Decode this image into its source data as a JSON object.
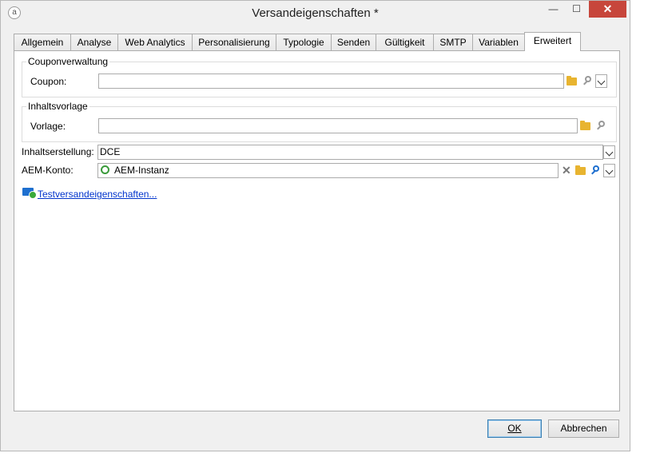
{
  "window": {
    "title": "Versandeigenschaften *",
    "minimize_glyph": "—",
    "maximize_glyph": "☐",
    "close_glyph": "✕"
  },
  "tabs": [
    {
      "label": "Allgemein"
    },
    {
      "label": "Analyse"
    },
    {
      "label": "Web Analytics"
    },
    {
      "label": "Personalisierung"
    },
    {
      "label": "Typologie"
    },
    {
      "label": "Senden"
    },
    {
      "label": "Gültigkeit"
    },
    {
      "label": "SMTP"
    },
    {
      "label": "Variablen"
    },
    {
      "label": "Erweitert",
      "active": true
    }
  ],
  "coupon_group": {
    "title": "Couponverwaltung",
    "label": "Coupon:",
    "value": ""
  },
  "template_group": {
    "title": "Inhaltsvorlage",
    "label": "Vorlage:",
    "value": ""
  },
  "content_creation": {
    "label": "Inhaltserstellung:",
    "value": "DCE"
  },
  "aem_account": {
    "label": "AEM-Konto:",
    "value": "AEM-Instanz"
  },
  "test_properties_link": "Testversandeigenschaften...",
  "buttons": {
    "ok": "OK",
    "cancel": "Abbrechen"
  },
  "colors": {
    "accent": "#1e6fcf",
    "close_button": "#c7463b",
    "folder": "#e8b430"
  }
}
